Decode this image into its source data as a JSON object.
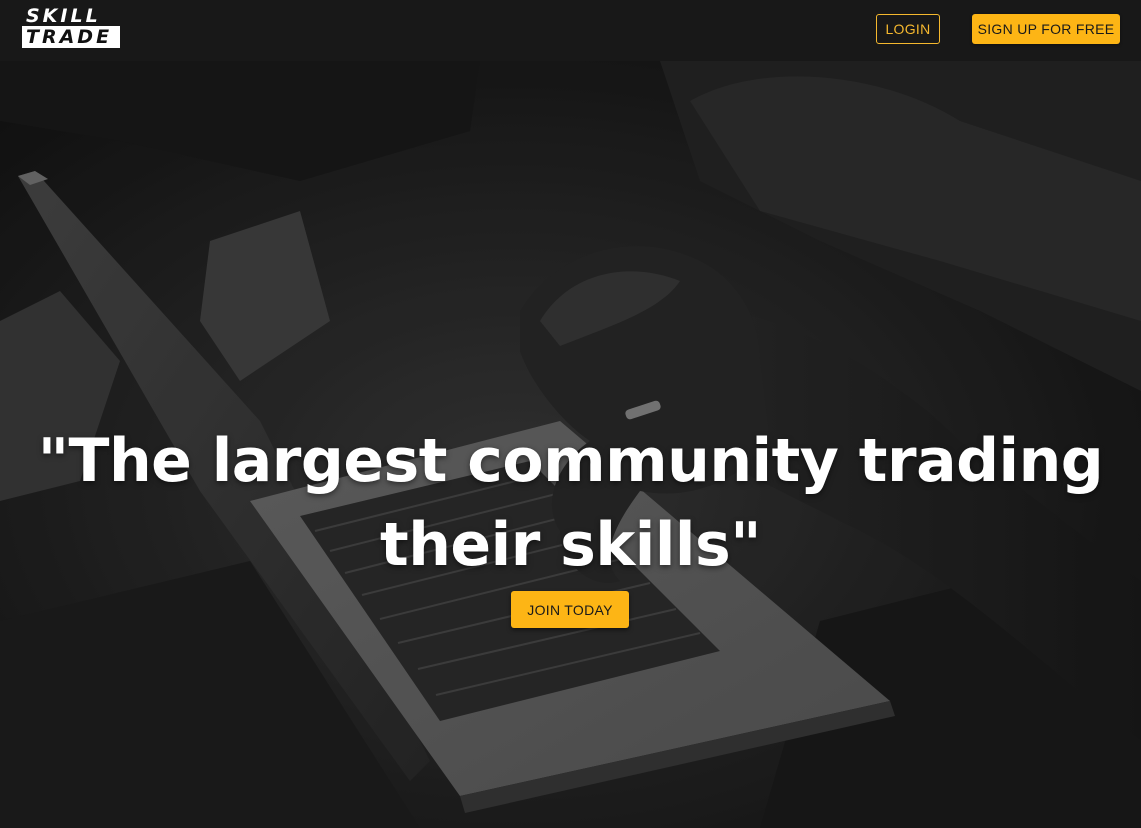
{
  "brand": {
    "logo_top": "SKILL",
    "logo_bottom": "TRADE"
  },
  "nav": {
    "login_label": "LOGIN",
    "signup_label": "SIGN UP FOR FREE"
  },
  "hero": {
    "headline": "\"The largest community trading their skills\"",
    "cta_label": "JOIN TODAY",
    "background_icon": "laptop-typing-photo-icon"
  },
  "colors": {
    "accent": "#fdb515",
    "navbar_bg": "#181818",
    "text": "#ffffff"
  }
}
